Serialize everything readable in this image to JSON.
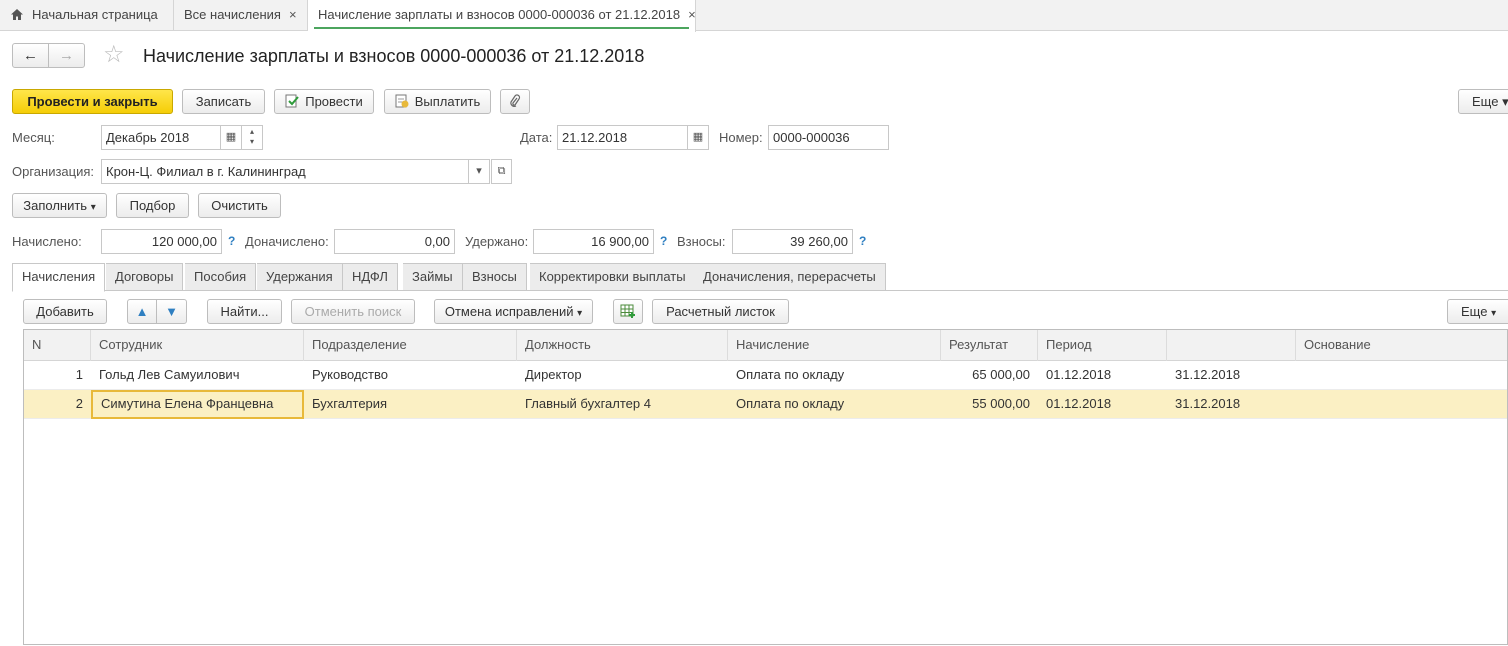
{
  "tabs": {
    "home": "Начальная страница",
    "all": "Все начисления",
    "active": "Начисление зарплаты и взносов 0000-000036 от 21.12.2018",
    "close": "×"
  },
  "header": {
    "title": "Начисление зарплаты и взносов 0000-000036 от 21.12.2018",
    "back": "←",
    "forward": "→",
    "star": "☆"
  },
  "toolbar": {
    "post_close": "Провести и закрыть",
    "save": "Записать",
    "post": "Провести",
    "pay": "Выплатить",
    "more": "Еще",
    "dropdown": "▾"
  },
  "form": {
    "month_label": "Месяц:",
    "month_value": "Декабрь 2018",
    "date_label": "Дата:",
    "date_value": "21.12.2018",
    "number_label": "Номер:",
    "number_value": "0000-000036",
    "org_label": "Организация:",
    "org_value": "Крон-Ц. Филиал в г. Калининград",
    "fill": "Заполнить",
    "select": "Подбор",
    "clear": "Очистить",
    "accrued_label": "Начислено:",
    "accrued_value": "120 000,00",
    "additional_label": "Доначислено:",
    "additional_value": "0,00",
    "withheld_label": "Удержано:",
    "withheld_value": "16 900,00",
    "contrib_label": "Взносы:",
    "contrib_value": "39 260,00",
    "q": "?"
  },
  "inner_tabs": [
    "Начисления",
    "Договоры",
    "Пособия",
    "Удержания",
    "НДФЛ",
    "Займы",
    "Взносы",
    "Корректировки выплаты",
    "Доначисления, перерасчеты"
  ],
  "table_toolbar": {
    "add": "Добавить",
    "find": "Найти...",
    "cancel_search": "Отменить поиск",
    "cancel_fix": "Отмена исправлений",
    "payslip": "Расчетный листок",
    "more": "Еще"
  },
  "table": {
    "headers": [
      "N",
      "Сотрудник",
      "Подразделение",
      "Должность",
      "Начисление",
      "Результат",
      "Период",
      "",
      "Основание"
    ],
    "rows": [
      {
        "n": "1",
        "employee": "Гольд Лев Самуилович",
        "dept": "Руководство",
        "position": "Директор",
        "accrual": "Оплата по окладу",
        "result": "65 000,00",
        "from": "01.12.2018",
        "to": "31.12.2018",
        "basis": ""
      },
      {
        "n": "2",
        "employee": "Симутина Елена Францевна",
        "dept": "Бухгалтерия",
        "position": "Главный бухгалтер 4",
        "accrual": "Оплата по окладу",
        "result": "55 000,00",
        "from": "01.12.2018",
        "to": "31.12.2018",
        "basis": ""
      }
    ]
  }
}
